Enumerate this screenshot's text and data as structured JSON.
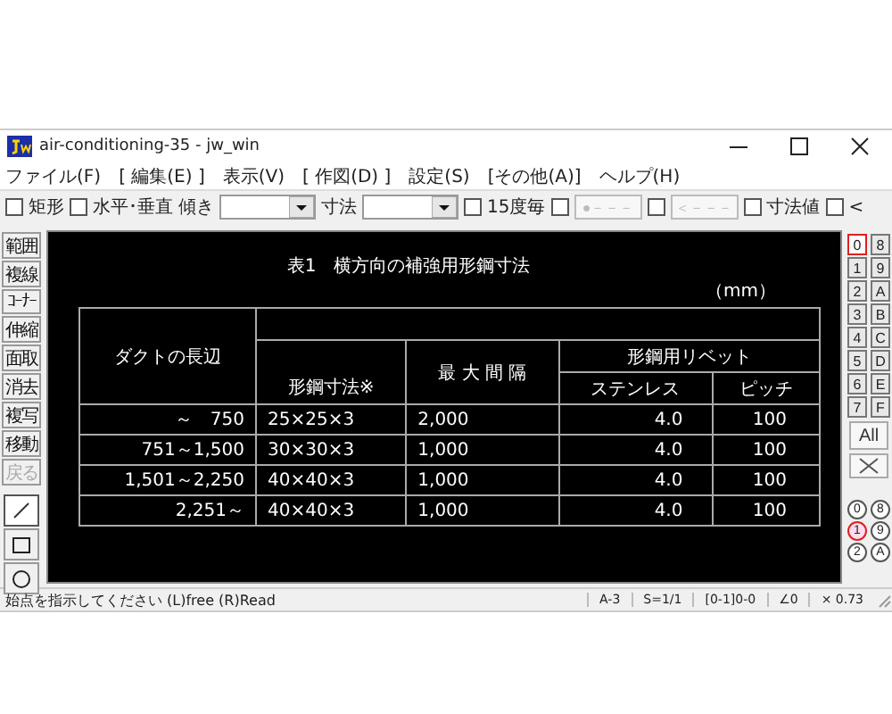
{
  "window": {
    "title": "air-conditioning-35 - jw_win"
  },
  "menu": [
    {
      "label": "ファイル(F)"
    },
    {
      "label": "[ 編集(E) ]"
    },
    {
      "label": "表示(V)"
    },
    {
      "label": "[ 作図(D) ]"
    },
    {
      "label": "設定(S)"
    },
    {
      "label": "[その他(A)]"
    },
    {
      "label": "ヘルプ(H)"
    }
  ],
  "toolbar": [
    {
      "kind": "check",
      "label": "矩形",
      "checked": false
    },
    {
      "kind": "check",
      "label": "水平･垂直",
      "checked": false
    },
    {
      "kind": "label",
      "label": "傾き"
    },
    {
      "kind": "combo"
    },
    {
      "kind": "label",
      "label": "寸法"
    },
    {
      "kind": "combo"
    },
    {
      "kind": "check",
      "label": "15度毎",
      "checked": false
    },
    {
      "kind": "check",
      "checked": false
    },
    {
      "kind": "button",
      "label": "●－－－",
      "disabled": true
    },
    {
      "kind": "check",
      "checked": false
    },
    {
      "kind": "button",
      "label": "＜－－－",
      "disabled": true
    },
    {
      "kind": "check",
      "label": "寸法値",
      "checked": false
    },
    {
      "kind": "check",
      "label": "<",
      "checked": false
    }
  ],
  "left_tools": [
    {
      "label": "範囲",
      "disabled": false
    },
    {
      "label": "複線",
      "disabled": false
    },
    {
      "label": "ｺｰﾅｰ",
      "disabled": false
    },
    {
      "label": "伸縮",
      "disabled": false
    },
    {
      "label": "面取",
      "disabled": false
    },
    {
      "label": "消去",
      "disabled": false
    },
    {
      "label": "複写",
      "disabled": false
    },
    {
      "label": "移動",
      "disabled": false
    },
    {
      "label": "戻る",
      "disabled": true
    }
  ],
  "shape_tools": [
    {
      "kind": "line",
      "selected": true
    },
    {
      "kind": "rect",
      "selected": false
    },
    {
      "kind": "circle",
      "selected": false
    }
  ],
  "layers": [
    {
      "label": "0",
      "selected": true
    },
    {
      "label": "8",
      "selected": false
    },
    {
      "label": "1",
      "selected": false
    },
    {
      "label": "9",
      "selected": false
    },
    {
      "label": "2",
      "selected": false
    },
    {
      "label": "A",
      "selected": false
    },
    {
      "label": "3",
      "selected": false
    },
    {
      "label": "B",
      "selected": false
    },
    {
      "label": "4",
      "selected": false
    },
    {
      "label": "C",
      "selected": false
    },
    {
      "label": "5",
      "selected": false
    },
    {
      "label": "D",
      "selected": false
    },
    {
      "label": "6",
      "selected": false
    },
    {
      "label": "E",
      "selected": false
    },
    {
      "label": "7",
      "selected": false
    },
    {
      "label": "F",
      "selected": false
    }
  ],
  "all_button": {
    "label": "All"
  },
  "groups": [
    {
      "label": "0",
      "selected": false
    },
    {
      "label": "8",
      "selected": false
    },
    {
      "label": "1",
      "selected": true
    },
    {
      "label": "9",
      "selected": false
    },
    {
      "label": "2",
      "selected": false
    },
    {
      "label": "A",
      "selected": false
    }
  ],
  "drawing": {
    "title": "表1　横方向の補強用形鋼寸法",
    "unit": "（mm）",
    "header": {
      "col1": "ダクトの長辺",
      "col2": "形鋼寸法※",
      "col3": "最 大 間 隔",
      "rivet": "形鋼用リベット",
      "col4": "ステンレス",
      "col5": "ピッチ"
    },
    "rows": [
      [
        "～　750",
        "25×25×3",
        "2,000",
        "4.0",
        "100"
      ],
      [
        "751～1,500",
        "30×30×3",
        "1,000",
        "4.0",
        "100"
      ],
      [
        "1,501～2,250",
        "40×40×3",
        "1,000",
        "4.0",
        "100"
      ],
      [
        "2,251～",
        "40×40×3",
        "1,000",
        "4.0",
        "100"
      ]
    ]
  },
  "status_bar": {
    "message": "始点を指示してください (L)free (R)Read",
    "fields": [
      "A-3",
      "S=1/1",
      "[0-1]0-0",
      "∠0",
      "× 0.73"
    ]
  }
}
